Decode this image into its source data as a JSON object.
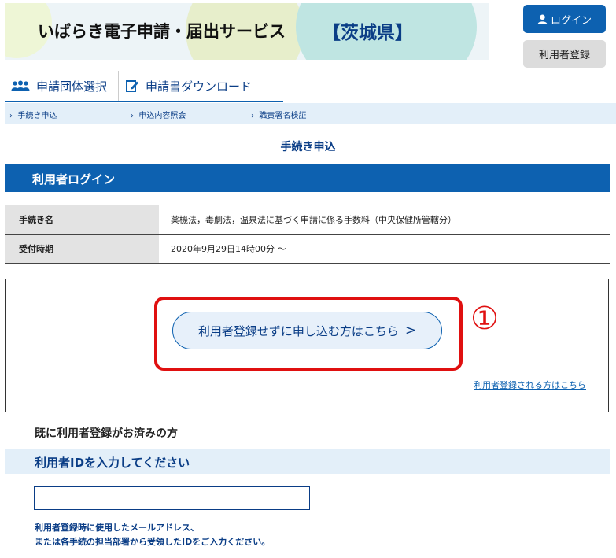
{
  "header": {
    "site_title": "いばらき電子申請・届出サービス",
    "prefecture": "【茨城県】",
    "login_label": "ログイン",
    "register_label": "利用者登録"
  },
  "nav": {
    "items": [
      {
        "label": "申請団体選択",
        "icon": "group-icon"
      },
      {
        "label": "申請書ダウンロード",
        "icon": "document-edit-icon"
      }
    ],
    "sub_items": [
      "手続き申込",
      "申込内容照会",
      "職責署名検証"
    ]
  },
  "page": {
    "title": "手続き申込",
    "login_heading": "利用者ログイン",
    "info": [
      {
        "label": "手続き名",
        "value": "薬機法，毒劇法，温泉法に基づく申請に係る手数料（中央保健所管轄分）"
      },
      {
        "label": "受付時期",
        "value": "2020年9月29日14時00分 ～"
      }
    ],
    "apply_without_register": "利用者登録せずに申し込む方はこちら",
    "apply_arrow": ">",
    "annotation": "①",
    "register_link": "利用者登録される方はこちら",
    "already_registered": "既に利用者登録がお済みの方",
    "id_heading": "利用者IDを入力してください",
    "id_value": "",
    "hint_line1": "利用者登録時に使用したメールアドレス、",
    "hint_line2": "または各手続の担当部署から受領したIDをご入力ください。"
  },
  "colors": {
    "primary": "#0d61b0",
    "dark_blue": "#0a3d86",
    "highlight_red": "#e01010",
    "light_blue": "#e3eff9"
  }
}
